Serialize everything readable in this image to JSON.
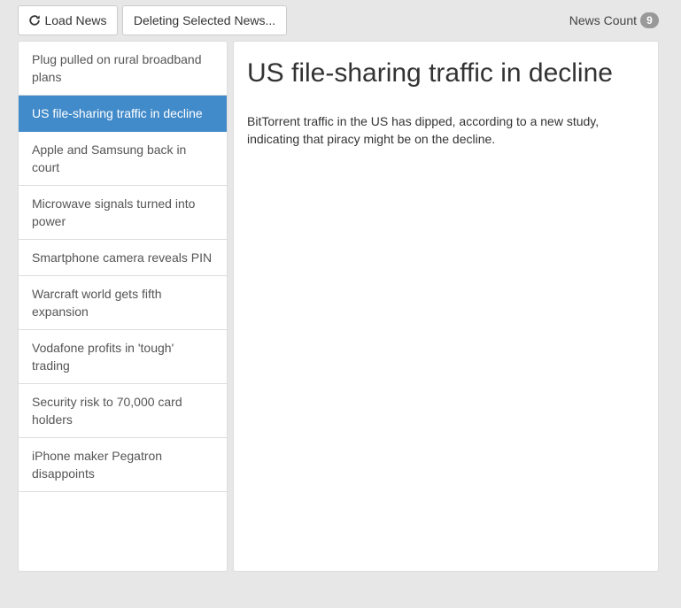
{
  "toolbar": {
    "load_label": "Load News",
    "load_icon": "refresh-icon",
    "delete_label": "Deleting Selected News...",
    "news_count_label": "News Count",
    "news_count_value": "9"
  },
  "news": {
    "items": [
      {
        "title": "Plug pulled on rural broadband plans"
      },
      {
        "title": "US file-sharing traffic in decline"
      },
      {
        "title": "Apple and Samsung back in court"
      },
      {
        "title": "Microwave signals turned into power"
      },
      {
        "title": "Smartphone camera reveals PIN"
      },
      {
        "title": "Warcraft world gets fifth expansion"
      },
      {
        "title": "Vodafone profits in 'tough' trading"
      },
      {
        "title": "Security risk to 70,000 card holders"
      },
      {
        "title": "iPhone maker Pegatron disappoints"
      }
    ],
    "selected_index": 1
  },
  "detail": {
    "title": "US file-sharing traffic in decline",
    "body": "BitTorrent traffic in the US has dipped, according to a new study, indicating that piracy might be on the decline."
  },
  "colors": {
    "active": "#428bca",
    "badge": "#999999",
    "background": "#e7e7e7"
  }
}
